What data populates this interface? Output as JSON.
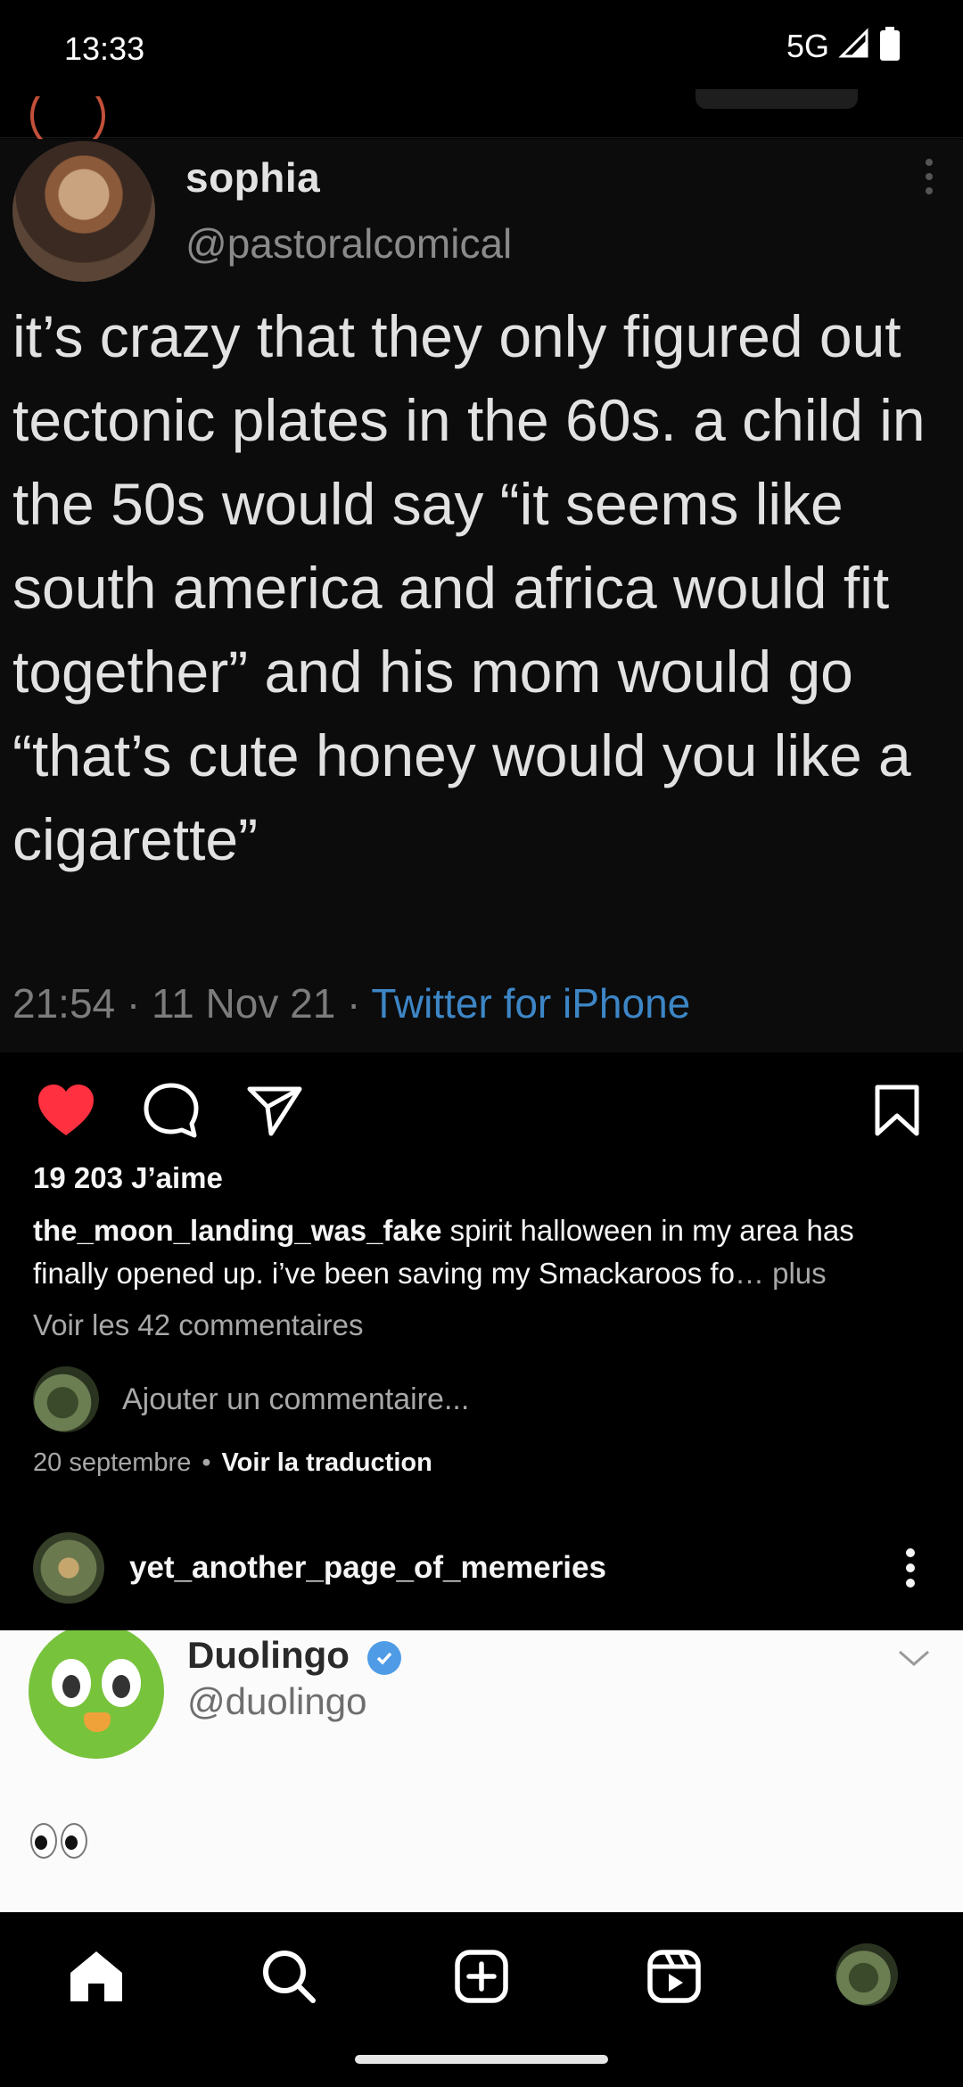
{
  "status_bar": {
    "time": "13:33",
    "network": "5G"
  },
  "tweet": {
    "name": "sophia",
    "handle": "@pastoralcomical",
    "text": "it’s crazy that they only figured out tectonic plates in the 60s. a child in the 50s would say “it seems like south america and africa would fit together” and his mom would go “that’s cute honey would you like a cigarette”",
    "meta_time": "21:54 · 11 Nov 21 · ",
    "meta_source": "Twitter for iPhone"
  },
  "post": {
    "likes": "19 203 J’aime",
    "caption_user": "the_moon_landing_was_fake",
    "caption_text": " spirit halloween in my area has finally opened up. i’ve been saving my Smackaroos fo",
    "caption_ellipsis": "…",
    "caption_more": " plus",
    "view_comments": "Voir les 42 commentaires",
    "add_comment_placeholder": "Ajouter un commentaire...",
    "date": "20 septembre",
    "dot": "•",
    "translate": "Voir la traduction",
    "like_color": "#ff3040"
  },
  "next_post": {
    "username": "yet_another_page_of_memeries",
    "tweet_name": "Duolingo",
    "tweet_handle": "@duolingo"
  }
}
